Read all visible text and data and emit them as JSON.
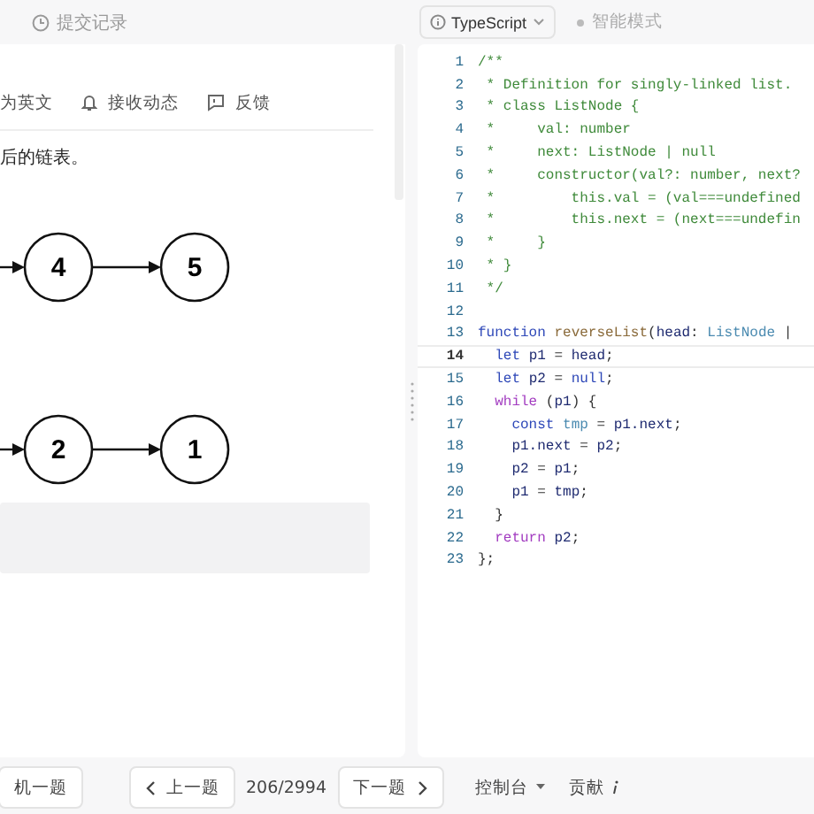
{
  "top_bar": {
    "left_tab": "提交记录",
    "language": "TypeScript",
    "mode": "智能模式"
  },
  "problem": {
    "toolbar": [
      {
        "kind": "translate",
        "label": "为英文"
      },
      {
        "kind": "bell",
        "label": "接收动态"
      },
      {
        "kind": "feedback",
        "label": "反馈"
      }
    ],
    "text": "后的链表。",
    "diagrams": [
      [
        "4",
        "5"
      ],
      [
        "2",
        "1"
      ]
    ]
  },
  "code_lines": [
    {
      "number": "1",
      "current": false,
      "tokens": [
        {
          "kind": "comment",
          "text": "/**"
        }
      ]
    },
    {
      "number": "2",
      "current": false,
      "tokens": [
        {
          "kind": "comment",
          "text": " * Definition for singly-linked list."
        }
      ]
    },
    {
      "number": "3",
      "current": false,
      "tokens": [
        {
          "kind": "comment",
          "text": " * class ListNode {"
        }
      ]
    },
    {
      "number": "4",
      "current": false,
      "tokens": [
        {
          "kind": "comment",
          "text": " *     val: number"
        }
      ]
    },
    {
      "number": "5",
      "current": false,
      "tokens": [
        {
          "kind": "comment",
          "text": " *     next: ListNode | null"
        }
      ]
    },
    {
      "number": "6",
      "current": false,
      "tokens": [
        {
          "kind": "comment",
          "text": " *     constructor(val?: number, next?"
        }
      ]
    },
    {
      "number": "7",
      "current": false,
      "tokens": [
        {
          "kind": "comment",
          "text": " *         this.val = (val===undefined"
        }
      ]
    },
    {
      "number": "8",
      "current": false,
      "tokens": [
        {
          "kind": "comment",
          "text": " *         this.next = (next===undefin"
        }
      ]
    },
    {
      "number": "9",
      "current": false,
      "tokens": [
        {
          "kind": "comment",
          "text": " *     }"
        }
      ]
    },
    {
      "number": "10",
      "current": false,
      "tokens": [
        {
          "kind": "comment",
          "text": " * }"
        }
      ]
    },
    {
      "number": "11",
      "current": false,
      "tokens": [
        {
          "kind": "comment",
          "text": " */"
        }
      ]
    },
    {
      "number": "12",
      "current": false
    },
    {
      "number": "13",
      "current": false,
      "tokens": [
        {
          "kind": "keyword",
          "text": "function "
        },
        {
          "kind": "function",
          "text": "reverseList"
        },
        {
          "kind": "plain",
          "text": "("
        },
        {
          "kind": "variable",
          "text": "head"
        },
        {
          "kind": "plain",
          "text": ": "
        },
        {
          "kind": "type",
          "text": "ListNode"
        },
        {
          "kind": "plain",
          "text": " |"
        }
      ]
    },
    {
      "number": "14",
      "current": true,
      "tokens": [
        {
          "kind": "keyword",
          "text": "  let "
        },
        {
          "kind": "variable",
          "text": "p1"
        },
        {
          "kind": "plain",
          "text": " = "
        },
        {
          "kind": "variable",
          "text": "head"
        },
        {
          "kind": "plain",
          "text": ";"
        }
      ]
    },
    {
      "number": "15",
      "current": false,
      "tokens": [
        {
          "kind": "keyword",
          "text": "  let "
        },
        {
          "kind": "variable",
          "text": "p2"
        },
        {
          "kind": "plain",
          "text": " = "
        },
        {
          "kind": "keyword",
          "text": "null"
        },
        {
          "kind": "plain",
          "text": ";"
        }
      ]
    },
    {
      "number": "16",
      "current": false,
      "tokens": [
        {
          "kind": "control",
          "text": "  while "
        },
        {
          "kind": "plain",
          "text": "("
        },
        {
          "kind": "variable",
          "text": "p1"
        },
        {
          "kind": "plain",
          "text": ") {"
        }
      ]
    },
    {
      "number": "17",
      "current": false,
      "tokens": [
        {
          "kind": "keyword",
          "text": "    const "
        },
        {
          "kind": "type",
          "text": "tmp"
        },
        {
          "kind": "plain",
          "text": " = "
        },
        {
          "kind": "variable",
          "text": "p1.next"
        },
        {
          "kind": "plain",
          "text": ";"
        }
      ]
    },
    {
      "number": "18",
      "current": false,
      "tokens": [
        {
          "kind": "variable",
          "text": "    p1.next"
        },
        {
          "kind": "plain",
          "text": " = "
        },
        {
          "kind": "variable",
          "text": "p2"
        },
        {
          "kind": "plain",
          "text": ";"
        }
      ]
    },
    {
      "number": "19",
      "current": false,
      "tokens": [
        {
          "kind": "variable",
          "text": "    p2"
        },
        {
          "kind": "plain",
          "text": " = "
        },
        {
          "kind": "variable",
          "text": "p1"
        },
        {
          "kind": "plain",
          "text": ";"
        }
      ]
    },
    {
      "number": "20",
      "current": false,
      "tokens": [
        {
          "kind": "variable",
          "text": "    p1"
        },
        {
          "kind": "plain",
          "text": " = "
        },
        {
          "kind": "variable",
          "text": "tmp"
        },
        {
          "kind": "plain",
          "text": ";"
        }
      ]
    },
    {
      "number": "21",
      "current": false,
      "tokens": [
        {
          "kind": "plain",
          "text": "  }"
        }
      ]
    },
    {
      "number": "22",
      "current": false,
      "tokens": [
        {
          "kind": "control",
          "text": "  return "
        },
        {
          "kind": "variable",
          "text": "p2"
        },
        {
          "kind": "plain",
          "text": ";"
        }
      ]
    },
    {
      "number": "23",
      "current": false,
      "tokens": [
        {
          "kind": "plain",
          "text": "};"
        }
      ]
    }
  ],
  "bottom_bar": {
    "random": "机一题",
    "prev": "上一题",
    "counter": "206/2994",
    "next": "下一题",
    "console": "控制台",
    "contribute": "贡献"
  }
}
